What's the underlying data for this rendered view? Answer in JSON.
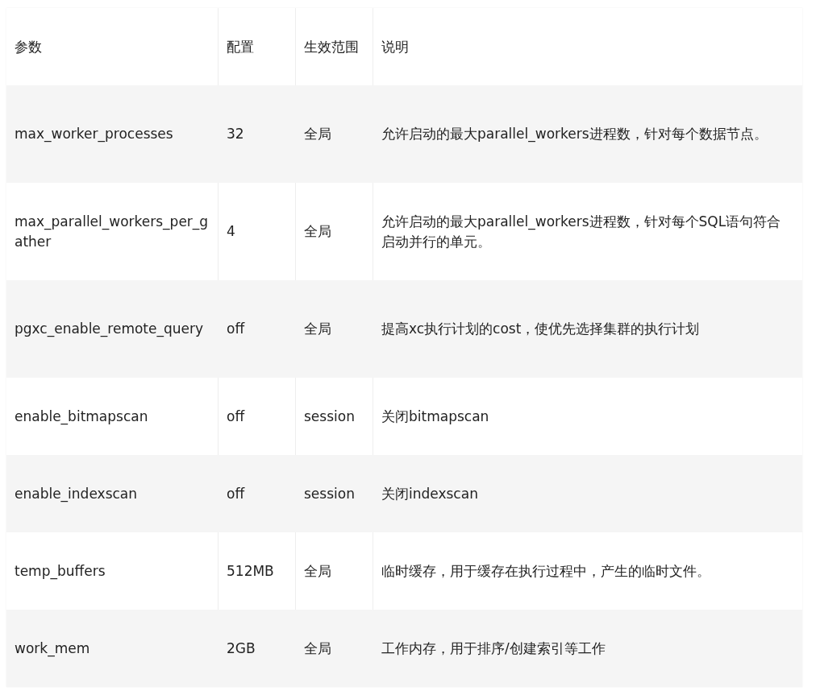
{
  "table": {
    "columns": [
      "参数",
      "配置",
      "生效范围",
      "说明"
    ],
    "rows": [
      [
        "max_worker_processes",
        "32",
        "全局",
        "允许启动的最大parallel_workers进程数，针对每个数据节点。"
      ],
      [
        "max_parallel_workers_per_gather",
        "4",
        "全局",
        "允许启动的最大parallel_workers进程数，针对每个SQL语句符合启动并行的单元。"
      ],
      [
        "pgxc_enable_remote_query",
        "off",
        "全局",
        "提高xc执行计划的cost，使优先选择集群的执行计划"
      ],
      [
        "enable_bitmapscan",
        "off",
        "session",
        "关闭bitmapscan"
      ],
      [
        "enable_indexscan",
        "off",
        "session",
        "关闭indexscan"
      ],
      [
        "temp_buffers",
        "512MB",
        "全局",
        "临时缓存，用于缓存在执行过程中，产生的临时文件。"
      ],
      [
        "work_mem",
        "2GB",
        "全局",
        "工作内存，用于排序/创建索引等工作"
      ]
    ]
  }
}
